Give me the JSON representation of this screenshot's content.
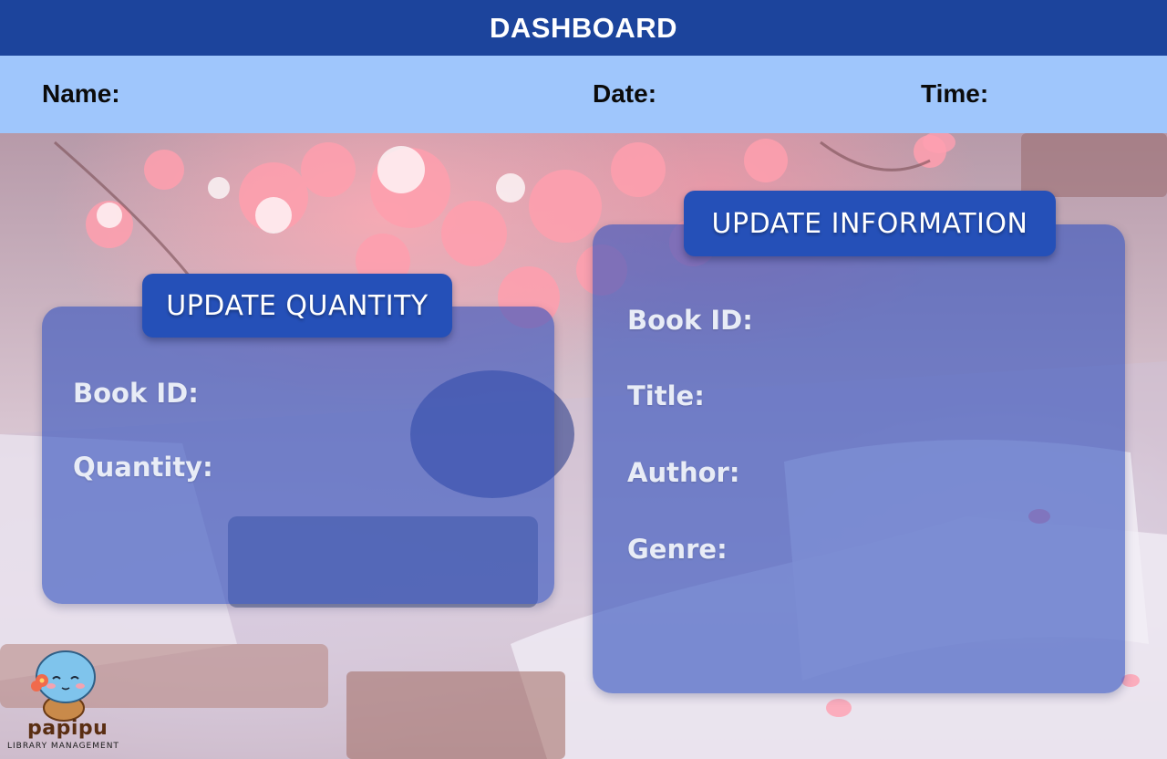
{
  "header": {
    "title": "DASHBOARD"
  },
  "info_bar": {
    "name_label": "Name:",
    "date_label": "Date:",
    "time_label": "Time:"
  },
  "update_quantity": {
    "heading": "UPDATE QUANTITY",
    "fields": [
      {
        "label": "Book ID:"
      },
      {
        "label": "Quantity:"
      }
    ]
  },
  "update_information": {
    "heading": "UPDATE INFORMATION",
    "fields": [
      {
        "label": "Book ID:"
      },
      {
        "label": "Title:"
      },
      {
        "label": "Author:"
      },
      {
        "label": "Genre:"
      }
    ]
  },
  "logo": {
    "wordmark": "papipu",
    "tagline": "LIBRARY MANAGEMENT"
  },
  "colors": {
    "header_bg": "#1c449c",
    "info_bar_bg": "#9fc6fc",
    "panel_bg": "rgba(52, 82, 190, 0.62)",
    "heading_bg": "#2550b8"
  }
}
